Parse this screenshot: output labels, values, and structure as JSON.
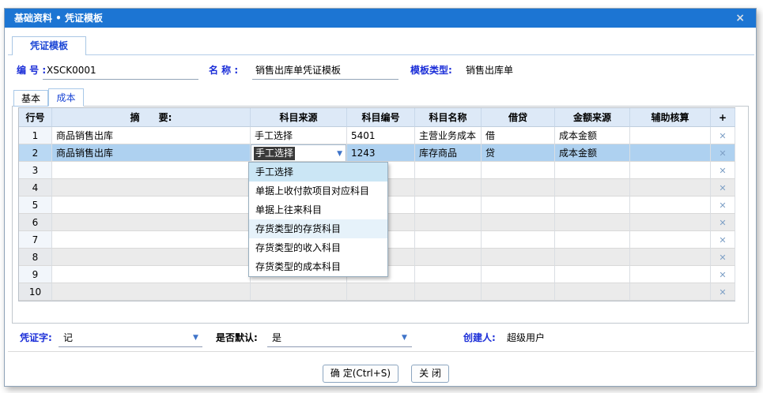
{
  "window": {
    "title": "基础资料 • 凭证模板",
    "close": "×"
  },
  "main_tab": {
    "label": "凭证模板"
  },
  "fields": {
    "code_label": "编 号 :",
    "code_value": "XSCK0001",
    "name_label": "名 称 :",
    "name_value": "销售出库单凭证模板",
    "type_label": "模板类型:",
    "type_value": "销售出库单"
  },
  "sub_tabs": {
    "basic": "基本",
    "cost": "成本"
  },
  "grid": {
    "headers": [
      "行号",
      "摘　　要:",
      "科目来源",
      "科目编号",
      "科目名称",
      "借贷",
      "金额来源",
      "辅助核算",
      "+"
    ],
    "rows": [
      {
        "no": "1",
        "summary": "商品销售出库",
        "source": "手工选择",
        "acct_no": "5401",
        "acct_name": "主营业务成本",
        "dc": "借",
        "amount_source": "成本金额",
        "aux": "",
        "selected": false
      },
      {
        "no": "2",
        "summary": "商品销售出库",
        "source": "手工选择",
        "acct_no": "1243",
        "acct_name": "库存商品",
        "dc": "贷",
        "amount_source": "成本金额",
        "aux": "",
        "selected": true
      },
      {
        "no": "3",
        "summary": "",
        "source": "",
        "acct_no": "",
        "acct_name": "",
        "dc": "",
        "amount_source": "",
        "aux": "",
        "selected": false
      },
      {
        "no": "4",
        "summary": "",
        "source": "",
        "acct_no": "",
        "acct_name": "",
        "dc": "",
        "amount_source": "",
        "aux": "",
        "selected": false
      },
      {
        "no": "5",
        "summary": "",
        "source": "",
        "acct_no": "",
        "acct_name": "",
        "dc": "",
        "amount_source": "",
        "aux": "",
        "selected": false
      },
      {
        "no": "6",
        "summary": "",
        "source": "",
        "acct_no": "",
        "acct_name": "",
        "dc": "",
        "amount_source": "",
        "aux": "",
        "selected": false
      },
      {
        "no": "7",
        "summary": "",
        "source": "",
        "acct_no": "",
        "acct_name": "",
        "dc": "",
        "amount_source": "",
        "aux": "",
        "selected": false
      },
      {
        "no": "8",
        "summary": "",
        "source": "",
        "acct_no": "",
        "acct_name": "",
        "dc": "",
        "amount_source": "",
        "aux": "",
        "selected": false
      },
      {
        "no": "9",
        "summary": "",
        "source": "",
        "acct_no": "",
        "acct_name": "",
        "dc": "",
        "amount_source": "",
        "aux": "",
        "selected": false
      },
      {
        "no": "10",
        "summary": "",
        "source": "",
        "acct_no": "",
        "acct_name": "",
        "dc": "",
        "amount_source": "",
        "aux": "",
        "selected": false
      }
    ]
  },
  "dropdown": {
    "options": [
      {
        "label": "手工选择",
        "state": "selected"
      },
      {
        "label": "单据上收付款项目对应科目",
        "state": ""
      },
      {
        "label": "单据上往来科目",
        "state": ""
      },
      {
        "label": "存货类型的存货科目",
        "state": "hover"
      },
      {
        "label": "存货类型的收入科目",
        "state": ""
      },
      {
        "label": "存货类型的成本科目",
        "state": ""
      }
    ]
  },
  "footer": {
    "voucher_word_label": "凭证字:",
    "voucher_word_value": "记",
    "default_label": "是否默认:",
    "default_value": "是",
    "creator_label": "创建人:",
    "creator_value": "超级用户"
  },
  "buttons": {
    "ok": "确 定(Ctrl+S)",
    "close": "关 闭"
  },
  "icons": {
    "combo_arrow": "▼",
    "delete_row": "✕"
  },
  "colors": {
    "titlebar": "#1c75d3",
    "label_blue": "#1b2ed8",
    "tab_blue": "#1b46d5",
    "header_bg": "#dde9f7",
    "selected_row": "#aed1f0",
    "stripe_row": "#ebebeb",
    "dropdown_selected": "#cbe6f5",
    "dropdown_hover": "#e6f2fa"
  }
}
